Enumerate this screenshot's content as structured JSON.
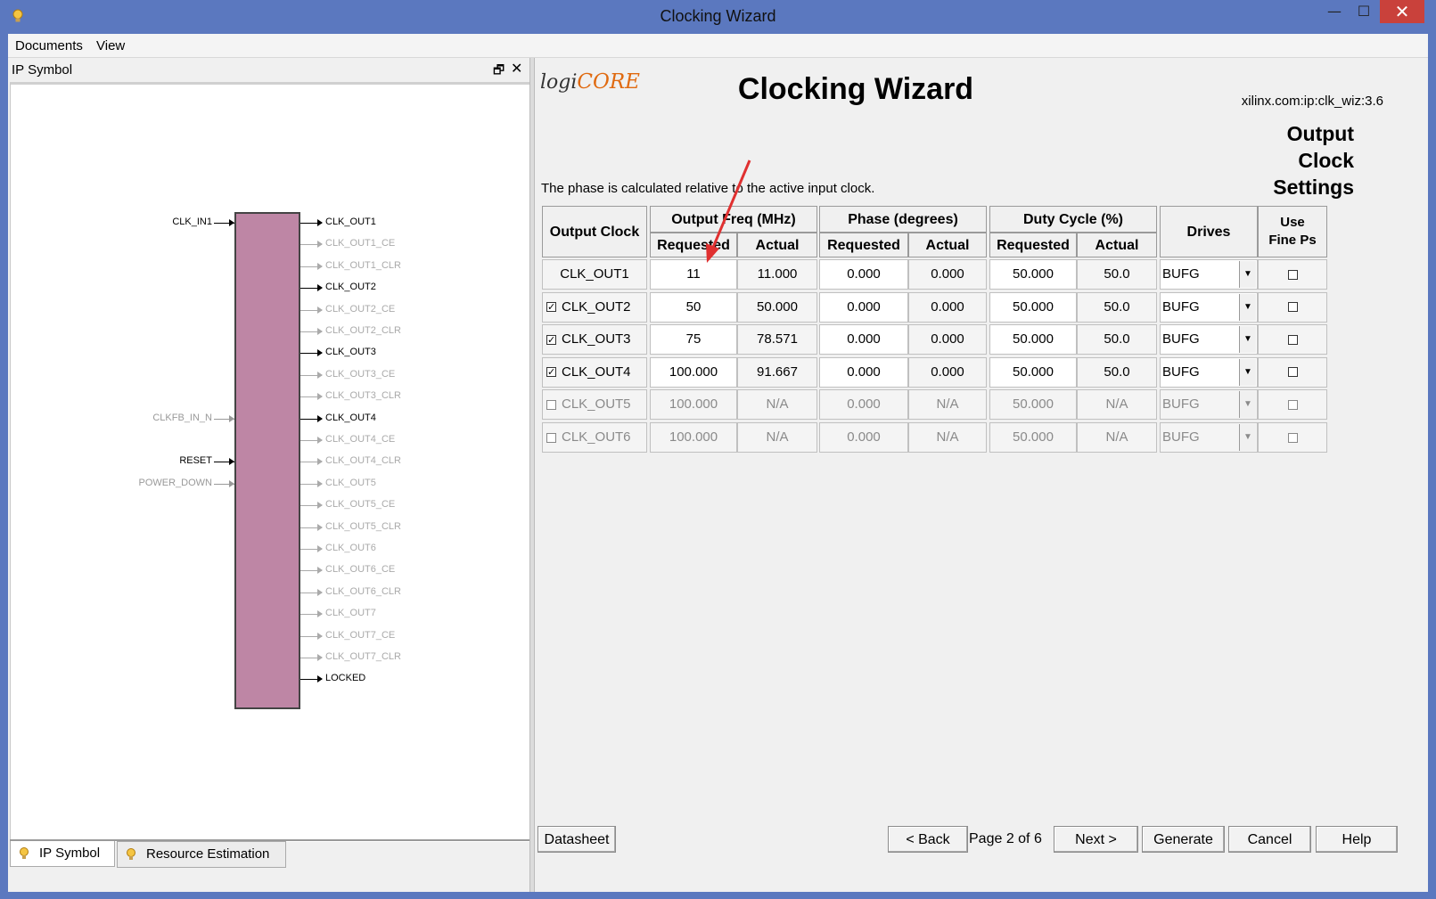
{
  "window": {
    "title": "Clocking Wizard",
    "minimize": "—",
    "maximize": "☐",
    "close": "✕"
  },
  "menu": [
    "Documents",
    "View"
  ],
  "left_panel": {
    "title": "IP Symbol",
    "restore_glyph": "🗗",
    "close_glyph": "✕",
    "inputs": [
      {
        "name": "CLK_IN1",
        "active": true
      },
      {
        "name": "CLKFB_IN_N",
        "active": false
      },
      {
        "name": "RESET",
        "active": true
      },
      {
        "name": "POWER_DOWN",
        "active": false
      }
    ],
    "outputs": [
      {
        "name": "CLK_OUT1",
        "active": true
      },
      {
        "name": "CLK_OUT1_CE",
        "active": false
      },
      {
        "name": "CLK_OUT1_CLR",
        "active": false
      },
      {
        "name": "CLK_OUT2",
        "active": true
      },
      {
        "name": "CLK_OUT2_CE",
        "active": false
      },
      {
        "name": "CLK_OUT2_CLR",
        "active": false
      },
      {
        "name": "CLK_OUT3",
        "active": true
      },
      {
        "name": "CLK_OUT3_CE",
        "active": false
      },
      {
        "name": "CLK_OUT3_CLR",
        "active": false
      },
      {
        "name": "CLK_OUT4",
        "active": true
      },
      {
        "name": "CLK_OUT4_CE",
        "active": false
      },
      {
        "name": "CLK_OUT4_CLR",
        "active": false
      },
      {
        "name": "CLK_OUT5",
        "active": false
      },
      {
        "name": "CLK_OUT5_CE",
        "active": false
      },
      {
        "name": "CLK_OUT5_CLR",
        "active": false
      },
      {
        "name": "CLK_OUT6",
        "active": false
      },
      {
        "name": "CLK_OUT6_CE",
        "active": false
      },
      {
        "name": "CLK_OUT6_CLR",
        "active": false
      },
      {
        "name": "CLK_OUT7",
        "active": false
      },
      {
        "name": "CLK_OUT7_CE",
        "active": false
      },
      {
        "name": "CLK_OUT7_CLR",
        "active": false
      },
      {
        "name": "LOCKED",
        "active": true
      }
    ],
    "tabs": [
      "IP Symbol",
      "Resource Estimation"
    ]
  },
  "header": {
    "logo_logi": "logi",
    "logo_core": "CORE",
    "title": "Clocking Wizard",
    "ip_name": "xilinx.com:ip:clk_wiz:3.6",
    "page_title_lines": [
      "Output",
      "Clock",
      "Settings"
    ]
  },
  "note": "The phase is calculated relative to the active input clock.",
  "table": {
    "headers": {
      "output_clock": "Output Clock",
      "freq": "Output Freq (MHz)",
      "phase": "Phase (degrees)",
      "duty": "Duty Cycle (%)",
      "drives": "Drives",
      "fine_ps_1": "Use",
      "fine_ps_2": "Fine Ps",
      "requested": "Requested",
      "actual": "Actual"
    },
    "rows": [
      {
        "name": "CLK_OUT1",
        "checkbox": null,
        "enabled": true,
        "freq_req": "11",
        "freq_act": "11.000",
        "phase_req": "0.000",
        "phase_act": "0.000",
        "duty_req": "50.000",
        "duty_act": "50.0",
        "drives": "BUFG",
        "fine_ps": false
      },
      {
        "name": "CLK_OUT2",
        "checkbox": true,
        "enabled": true,
        "freq_req": "50",
        "freq_act": "50.000",
        "phase_req": "0.000",
        "phase_act": "0.000",
        "duty_req": "50.000",
        "duty_act": "50.0",
        "drives": "BUFG",
        "fine_ps": false
      },
      {
        "name": "CLK_OUT3",
        "checkbox": true,
        "enabled": true,
        "freq_req": "75",
        "freq_act": "78.571",
        "phase_req": "0.000",
        "phase_act": "0.000",
        "duty_req": "50.000",
        "duty_act": "50.0",
        "drives": "BUFG",
        "fine_ps": false
      },
      {
        "name": "CLK_OUT4",
        "checkbox": true,
        "enabled": true,
        "freq_req": "100.000",
        "freq_act": "91.667",
        "phase_req": "0.000",
        "phase_act": "0.000",
        "duty_req": "50.000",
        "duty_act": "50.0",
        "drives": "BUFG",
        "fine_ps": false
      },
      {
        "name": "CLK_OUT5",
        "checkbox": false,
        "enabled": false,
        "freq_req": "100.000",
        "freq_act": "N/A",
        "phase_req": "0.000",
        "phase_act": "N/A",
        "duty_req": "50.000",
        "duty_act": "N/A",
        "drives": "BUFG",
        "fine_ps": false
      },
      {
        "name": "CLK_OUT6",
        "checkbox": false,
        "enabled": false,
        "freq_req": "100.000",
        "freq_act": "N/A",
        "phase_req": "0.000",
        "phase_act": "N/A",
        "duty_req": "50.000",
        "duty_act": "N/A",
        "drives": "BUFG",
        "fine_ps": false
      }
    ]
  },
  "footer": {
    "datasheet": "Datasheet",
    "back": "< Back",
    "page_info": "Page 2 of 6",
    "next": "Next >",
    "generate": "Generate",
    "cancel": "Cancel",
    "help": "Help"
  },
  "colors": {
    "title_bar": "#5b78bf",
    "close_button": "#c9413b",
    "symbol_fill": "#be86a5",
    "annotation_arrow": "#e03030",
    "logo_core": "#e06a10"
  }
}
